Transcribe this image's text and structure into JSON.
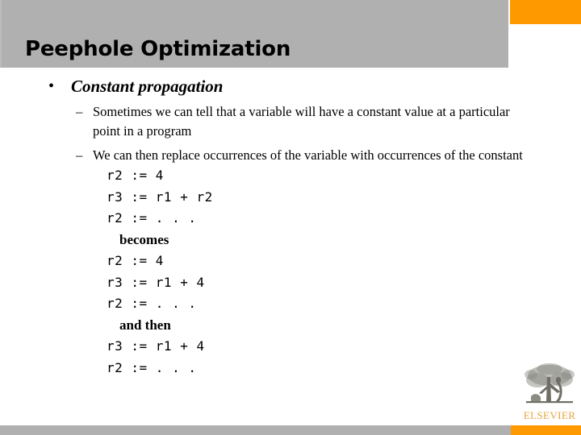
{
  "slide": {
    "title": "Peephole Optimization",
    "colors": {
      "header_band": "#B0B0B0",
      "accent_orange": "#FF9900",
      "text": "#000000",
      "logo_gold": "#E8A33D"
    }
  },
  "content": {
    "bullet_glyph": "•",
    "dash_glyph": "–",
    "level1": "Constant propagation",
    "level2": [
      "Sometimes we can tell that a variable will have a constant value at a particular point in a program",
      "We can then replace occurrences of the variable with occurrences of the constant"
    ],
    "code_block_1": [
      "r2 := 4",
      "r3 := r1 + r2",
      "r2 := . . ."
    ],
    "keyword_1": "becomes",
    "code_block_2": [
      "r2 := 4",
      "r3 := r1 + 4",
      "r2 := . . ."
    ],
    "keyword_2": "and then",
    "code_block_3": [
      "r3 := r1 + 4",
      "r2 := . . ."
    ]
  },
  "footer": {
    "logo_wordmark": "ELSEVIER"
  }
}
